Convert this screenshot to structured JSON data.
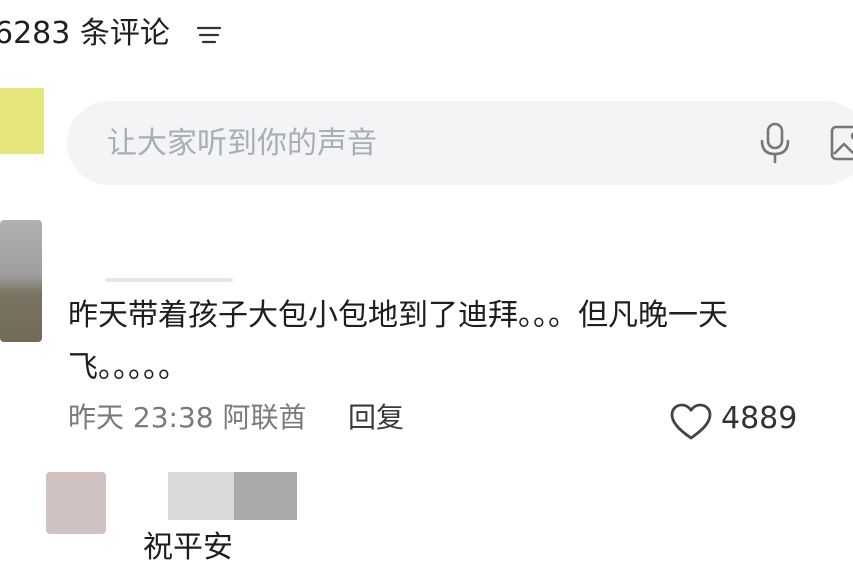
{
  "header": {
    "comment_count": "6283 条评论",
    "sort_icon": "filter-lines-icon"
  },
  "composer": {
    "placeholder": "让大家听到你的声音",
    "mic_icon": "microphone-icon",
    "image_icon": "image-icon"
  },
  "comment": {
    "text": "昨天带着孩子大包小包地到了迪拜。。。但凡晚一天飞。。。。。",
    "meta": "昨天 23:38 阿联酋",
    "reply_label": "回复",
    "like_icon": "heart-outline-icon",
    "likes": "4889"
  },
  "reply": {
    "text": "祝平安"
  },
  "colors": {
    "input_background": "#f3f4f6",
    "placeholder_text": "#a9adb4",
    "meta_text": "#7a7a7a"
  }
}
